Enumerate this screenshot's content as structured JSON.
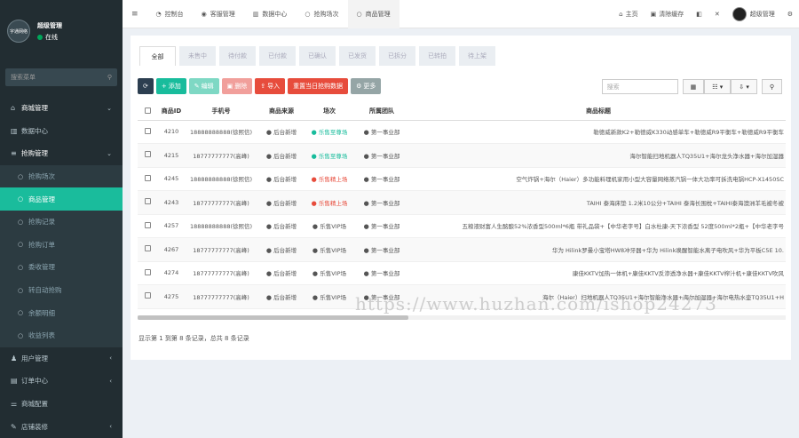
{
  "sidebar": {
    "logo_text": "字通网络",
    "user_name": "超级管理",
    "status_text": "在线",
    "status_color": "#00a65a",
    "search_placeholder": "搜索菜单",
    "menu": [
      {
        "label": "商城管理",
        "icon": "home-icon"
      },
      {
        "label": "数据中心",
        "icon": "chart-icon"
      },
      {
        "label": "抢购管理",
        "icon": "list-icon"
      }
    ],
    "submenu": [
      {
        "label": "抢购场次"
      },
      {
        "label": "商品管理"
      },
      {
        "label": "抢购记录"
      },
      {
        "label": "抢购订单"
      },
      {
        "label": "委收管理"
      },
      {
        "label": "转自动抢购"
      },
      {
        "label": "余额明细"
      },
      {
        "label": "收益列表"
      }
    ],
    "menu_bottom": [
      {
        "label": "用户管理",
        "icon": "user-icon"
      },
      {
        "label": "订单中心",
        "icon": "cart-icon"
      },
      {
        "label": "商城配置",
        "icon": "sliders-icon"
      },
      {
        "label": "店铺装修",
        "icon": "brush-icon"
      }
    ]
  },
  "topbar": {
    "tabs": [
      {
        "label": "控制台",
        "icon": "dashboard-icon"
      },
      {
        "label": "客服管理",
        "icon": "user-circle-icon"
      },
      {
        "label": "数据中心",
        "icon": "chart-icon"
      },
      {
        "label": "抢购场次",
        "icon": "circle-icon"
      },
      {
        "label": "商品管理",
        "icon": "circle-icon"
      }
    ],
    "right": {
      "home": "主页",
      "clear_cache": "清除缓存",
      "user": "超级管理"
    }
  },
  "status_tabs": [
    "全部",
    "未售中",
    "待付款",
    "已付款",
    "已确认",
    "已发货",
    "已拆分",
    "已转拍",
    "待上架"
  ],
  "toolbar": {
    "add": "添加",
    "edit": "编辑",
    "delete": "删除",
    "import": "导入",
    "reset": "重置当日抢购数据",
    "more": "更多",
    "search_placeholder": "搜索",
    "colors": {
      "refresh": "#2c3e50",
      "add": "#18bc9c",
      "edit": "#7ed8c4",
      "delete": "#f19f9b",
      "import": "#e74c3c",
      "reset": "#e74c3c",
      "more": "#95a5a6"
    }
  },
  "table": {
    "headers": [
      "商品ID",
      "手机号",
      "商品来源",
      "场次",
      "所属团队",
      "商品标题"
    ],
    "rows": [
      {
        "id": "4210",
        "phone": "18888888888(徐熙信)",
        "source": "后台新增",
        "session": "乐售至尊场",
        "session_color": "#18bc9c",
        "team": "第一事业部",
        "title": "勒德威新款K2+勒德威K330动感单车+勒德威R9平衡车+勒德威R9平衡车"
      },
      {
        "id": "4215",
        "phone": "18777777777(高峰)",
        "source": "后台新增",
        "session": "乐售至尊场",
        "session_color": "#18bc9c",
        "team": "第一事业部",
        "title": "海尔智能扫地机器人TQ35U1+海尔龙头净水器+海尔加湿器"
      },
      {
        "id": "4245",
        "phone": "18888888888(徐熙信)",
        "source": "后台新增",
        "session": "乐售精上场",
        "session_color": "#e74c3c",
        "team": "第一事业部",
        "title": "空气炸锅+海尔（Haier）多功能料理机家用小型大容量网络蒸汽锅一体大功率可拆洗电锅HCP-X1450SC"
      },
      {
        "id": "4243",
        "phone": "18777777777(高峰)",
        "source": "后台新增",
        "session": "乐售精上场",
        "session_color": "#e74c3c",
        "team": "第一事业部",
        "title": "TAIHI 泰海床垫 1.2米10公分+TAIHI 泰海长围枕+TAIHI泰海澳洲羊毛被冬被"
      },
      {
        "id": "4257",
        "phone": "18888888888(徐熙信)",
        "source": "后台新增",
        "session": "乐售VIP场",
        "session_color": "#2c3e50",
        "team": "第一事业部",
        "title": "五粮液财富人生酩酿52%浓香型500ml*6瓶 带礼品袋+【中华老字号】白水杜康-天下浓香型 52度500ml*2瓶+【中华老字号"
      },
      {
        "id": "4267",
        "phone": "18777777777(高峰)",
        "source": "后台新增",
        "session": "乐售VIP场",
        "session_color": "#2c3e50",
        "team": "第一事业部",
        "title": "华为 Hilink罗曼小宝塔HW8冲牙器+华为 Hilink唤醒智能水离子电吹风+华为平板C5E 10."
      },
      {
        "id": "4274",
        "phone": "18777777777(高峰)",
        "source": "后台新增",
        "session": "乐售VIP场",
        "session_color": "#2c3e50",
        "team": "第一事业部",
        "title": "康佳KKTV加热一体机+康佳KKTV反渗透净水器+康佳KKTV榨汁机+康佳KKTV吹风"
      },
      {
        "id": "4275",
        "phone": "18777777777(高峰)",
        "source": "后台新增",
        "session": "乐售VIP场",
        "session_color": "#2c3e50",
        "team": "第一事业部",
        "title": "海尔（Haier）扫地机器人TQ35U1+海尔智能净水器+海尔加湿器+海尔电热水壶TQ35U1+H"
      }
    ]
  },
  "footer": "显示第 1 到第 8 条记录，总共 8 条记录",
  "watermark": "https://www.huzhan.com/ishop24273"
}
